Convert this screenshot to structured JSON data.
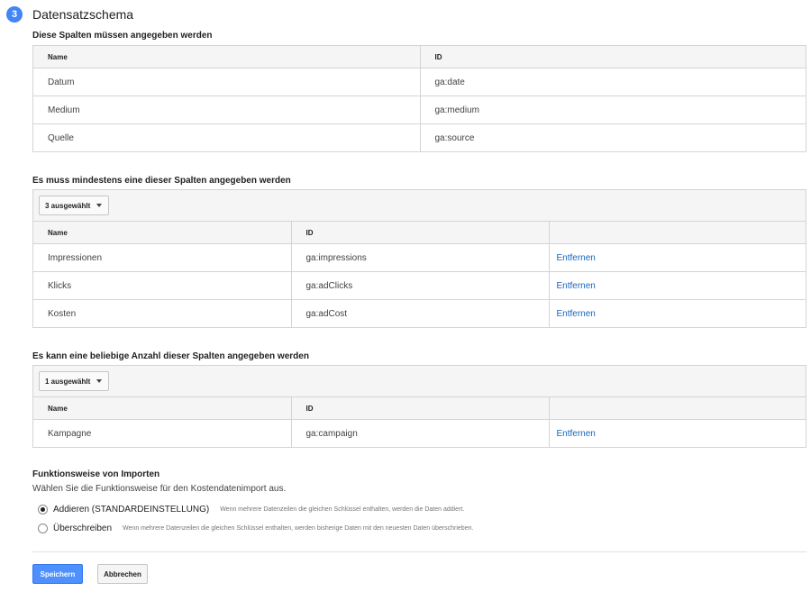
{
  "step": {
    "number": "3",
    "title": "Datensatzschema"
  },
  "required": {
    "title": "Diese Spalten müssen angegeben werden",
    "headers": [
      "Name",
      "ID"
    ],
    "rows": [
      {
        "name": "Datum",
        "id": "ga:date"
      },
      {
        "name": "Medium",
        "id": "ga:medium"
      },
      {
        "name": "Quelle",
        "id": "ga:source"
      }
    ]
  },
  "atleast": {
    "title": "Es muss mindestens eine dieser Spalten angegeben werden",
    "dropdown": "3 ausgewählt",
    "headers": [
      "Name",
      "ID",
      ""
    ],
    "rows": [
      {
        "name": "Impressionen",
        "id": "ga:impressions",
        "action": "Entfernen"
      },
      {
        "name": "Klicks",
        "id": "ga:adClicks",
        "action": "Entfernen"
      },
      {
        "name": "Kosten",
        "id": "ga:adCost",
        "action": "Entfernen"
      }
    ]
  },
  "optional": {
    "title": "Es kann eine beliebige Anzahl dieser Spalten angegeben werden",
    "dropdown": "1 ausgewählt",
    "headers": [
      "Name",
      "ID",
      ""
    ],
    "rows": [
      {
        "name": "Kampagne",
        "id": "ga:campaign",
        "action": "Entfernen"
      }
    ]
  },
  "import": {
    "title": "Funktionsweise von Importen",
    "subtitle": "Wählen Sie die Funktionsweise für den Kostendatenimport aus.",
    "options": [
      {
        "label": "Addieren (STANDARDEINSTELLUNG)",
        "desc": "Wenn mehrere Datenzeilen die gleichen Schlüssel enthalten, werden die Daten addiert.",
        "checked": true
      },
      {
        "label": "Überschreiben",
        "desc": "Wenn mehrere Datenzeilen die gleichen Schlüssel enthalten, werden bisherige Daten mit den neuesten Daten überschrieben.",
        "checked": false
      }
    ]
  },
  "buttons": {
    "save": "Speichern",
    "cancel": "Abbrechen"
  },
  "colors": {
    "accent": "#4285f4",
    "link": "#1565c0",
    "primary_button": "#4d90fe"
  }
}
